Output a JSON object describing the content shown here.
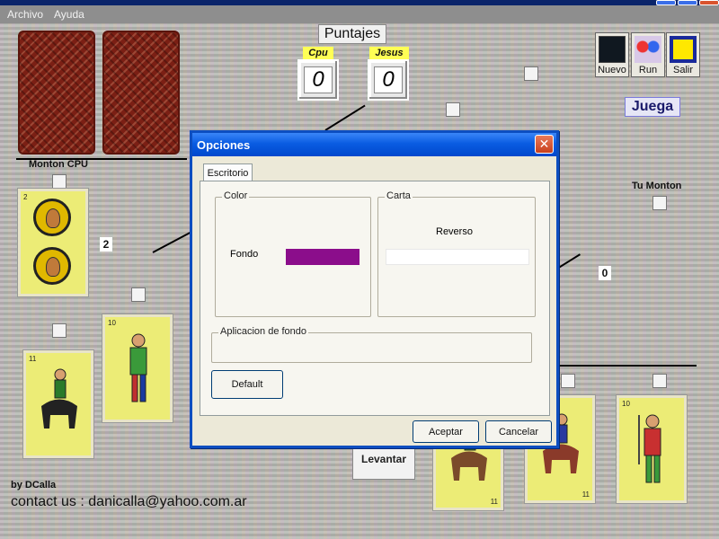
{
  "menubar": {
    "items": [
      "Archivo",
      "Ayuda"
    ]
  },
  "scores": {
    "title": "Puntajes",
    "players": [
      {
        "name": "Cpu",
        "score": "0"
      },
      {
        "name": "Jesus",
        "score": "0"
      }
    ]
  },
  "toolbar": {
    "nuevo": "Nuevo",
    "run": "Run",
    "salir": "Salir"
  },
  "juega_label": "Juega",
  "piles": {
    "cpu_label": "Monton CPU",
    "tu_label": "Tu Monton",
    "cpu_count": "2",
    "tu_count": "0"
  },
  "cards": {
    "coin_card_number": "2",
    "card_numbers": [
      "10",
      "11",
      "11",
      "11",
      "10"
    ]
  },
  "levantar_label": "Levantar",
  "footer": {
    "by": "by DCalla",
    "contact": "contact us : danicalla@yahoo.com.ar"
  },
  "dialog": {
    "title": "Opciones",
    "close": "✕",
    "tab": "Escritorio",
    "color_group": "Color",
    "fondo_label": "Fondo",
    "fondo_color": "#8b0d8b",
    "carta_group": "Carta",
    "reverso_label": "Reverso",
    "aplicacion_group": "Aplicacion de fondo",
    "default_button": "Default",
    "accept_button": "Aceptar",
    "cancel_button": "Cancelar"
  },
  "colors": {
    "dialog_border": "#0d4ec0",
    "title_bar": "#0a5ce2",
    "card_face": "#ecec76",
    "card_back": "#7b1f14"
  }
}
